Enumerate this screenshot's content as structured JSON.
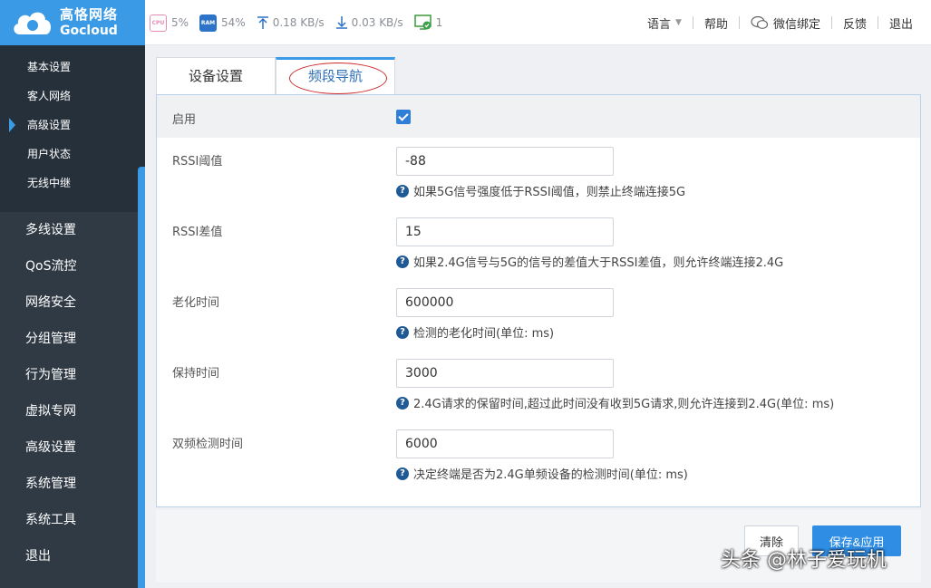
{
  "brand": {
    "name_cn": "高恪网络",
    "name_en": "Gocloud"
  },
  "stats": {
    "cpu_label": "CPU",
    "cpu": "5%",
    "ram_label": "RAM",
    "ram": "54%",
    "upload": "0.18 KB/s",
    "download": "0.03 KB/s",
    "online_users": "1"
  },
  "topnav": {
    "language": "语言",
    "help": "帮助",
    "wechat_bind": "微信绑定",
    "feedback": "反馈",
    "logout": "退出"
  },
  "sidebar": {
    "sub_items": [
      {
        "label": "基本设置"
      },
      {
        "label": "客人网络"
      },
      {
        "label": "高级设置",
        "active": true
      },
      {
        "label": "用户状态"
      },
      {
        "label": "无线中继"
      }
    ],
    "menu_items": [
      {
        "label": "多线设置"
      },
      {
        "label": "QoS流控"
      },
      {
        "label": "网络安全"
      },
      {
        "label": "分组管理"
      },
      {
        "label": "行为管理"
      },
      {
        "label": "虚拟专网"
      },
      {
        "label": "高级设置"
      },
      {
        "label": "系统管理"
      },
      {
        "label": "系统工具"
      },
      {
        "label": "退出"
      }
    ]
  },
  "tabs": [
    {
      "label": "设备设置"
    },
    {
      "label": "频段导航",
      "active": true
    }
  ],
  "form": {
    "enable_label": "启用",
    "enable_checked": true,
    "fields": [
      {
        "label": "RSSI阈值",
        "value": "-88",
        "hint": "如果5G信号强度低于RSSI阈值，则禁止终端连接5G"
      },
      {
        "label": "RSSI差值",
        "value": "15",
        "hint": "如果2.4G信号与5G的信号的差值大于RSSI差值，则允许终端连接2.4G"
      },
      {
        "label": "老化时间",
        "value": "600000",
        "hint": "检测的老化时间(单位: ms)"
      },
      {
        "label": "保持时间",
        "value": "3000",
        "hint": "2.4G请求的保留时间,超过此时间没有收到5G请求,则允许连接到2.4G(单位: ms)"
      },
      {
        "label": "双频检测时间",
        "value": "6000",
        "hint": "决定终端是否为2.4G单频设备的检测时间(单位: ms)"
      }
    ]
  },
  "buttons": {
    "clear": "清除",
    "save_apply": "保存&应用"
  },
  "watermark": "头条 @林子爱玩机",
  "colors": {
    "accent": "#3b9ae6",
    "sidebar_bg": "#2f3a45",
    "annotation": "#cc2a2a"
  }
}
